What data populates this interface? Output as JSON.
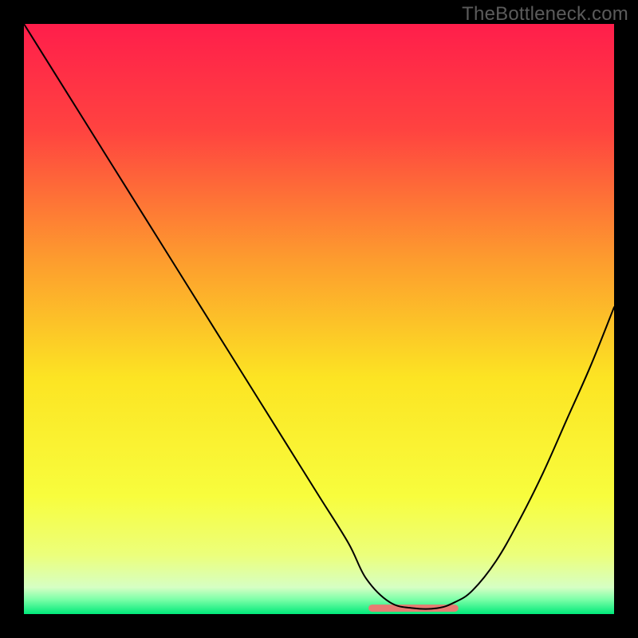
{
  "attribution": "TheBottleneck.com",
  "chart_data": {
    "type": "line",
    "title": "",
    "xlabel": "",
    "ylabel": "",
    "xlim": [
      0,
      100
    ],
    "ylim": [
      0,
      100
    ],
    "grid": false,
    "background_gradient": [
      {
        "offset": 0.0,
        "color": "#ff1e4b"
      },
      {
        "offset": 0.18,
        "color": "#ff4340"
      },
      {
        "offset": 0.4,
        "color": "#fd9c2e"
      },
      {
        "offset": 0.6,
        "color": "#fce423"
      },
      {
        "offset": 0.8,
        "color": "#f8fd3d"
      },
      {
        "offset": 0.9,
        "color": "#ecff7b"
      },
      {
        "offset": 0.955,
        "color": "#d6ffc4"
      },
      {
        "offset": 0.975,
        "color": "#7dffa8"
      },
      {
        "offset": 1.0,
        "color": "#00e97a"
      }
    ],
    "series": [
      {
        "name": "bottleneck-curve",
        "color": "#000000",
        "width": 2,
        "x": [
          0,
          5,
          10,
          15,
          20,
          25,
          30,
          35,
          40,
          45,
          50,
          55,
          58,
          62,
          66,
          70,
          73,
          76,
          80,
          84,
          88,
          92,
          96,
          100
        ],
        "values": [
          100,
          92,
          84,
          76,
          68,
          60,
          52,
          44,
          36,
          28,
          20,
          12,
          6,
          2,
          1,
          1,
          2,
          4,
          9,
          16,
          24,
          33,
          42,
          52
        ]
      }
    ],
    "flat_segment": {
      "name": "optimal-range-marker",
      "color": "#e77b72",
      "width": 9,
      "x_start": 59,
      "x_end": 73,
      "y": 1
    }
  }
}
